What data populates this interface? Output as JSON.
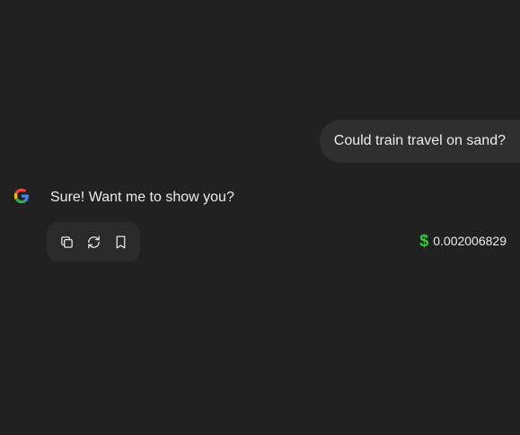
{
  "conversation": {
    "user_message": "Could train travel on sand?",
    "assistant_message": "Sure! Want me to show you?",
    "assistant_icon": "google-g-icon"
  },
  "actions": [
    {
      "name": "copy",
      "icon": "copy-icon"
    },
    {
      "name": "regenerate",
      "icon": "refresh-icon"
    },
    {
      "name": "bookmark",
      "icon": "bookmark-icon"
    }
  ],
  "cost": {
    "icon": "dollar-icon",
    "symbol": "$",
    "value": "0.002006829",
    "color": "#2ecc40"
  },
  "colors": {
    "background": "#212121",
    "bubble": "#2f2f2f",
    "action_bar": "#2a2a2a"
  }
}
